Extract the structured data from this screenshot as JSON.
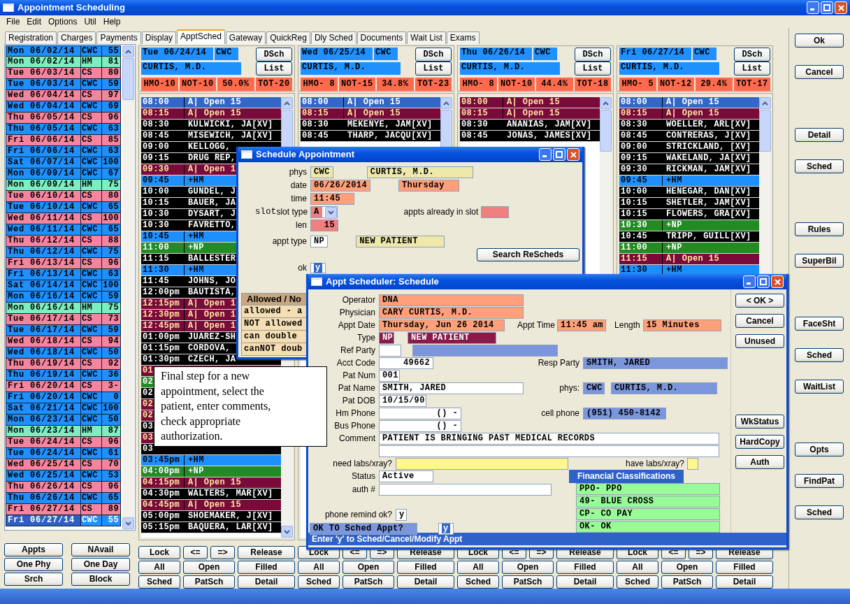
{
  "window": {
    "title": "Appointment Scheduling"
  },
  "menu": [
    "File",
    "Edit",
    "Options",
    "Util",
    "Help"
  ],
  "tabs": [
    {
      "label": "Registration",
      "selected": false
    },
    {
      "label": "Charges",
      "selected": false
    },
    {
      "label": "Payments",
      "selected": false
    },
    {
      "label": "Display",
      "selected": false
    },
    {
      "label": "ApptSched",
      "selected": true
    },
    {
      "label": "Gateway",
      "selected": false
    },
    {
      "label": "QuickReg",
      "selected": false
    },
    {
      "label": "Dly Sched",
      "selected": false
    },
    {
      "label": "Documents",
      "selected": false
    },
    {
      "label": "Wait List",
      "selected": false
    },
    {
      "label": "Exams",
      "selected": false
    }
  ],
  "date_list": {
    "items": [
      {
        "day": "Mon 06/02/14",
        "clinic": "CWC",
        "count": "55",
        "color": "#1e90ff",
        "selected": false
      },
      {
        "day": "Mon 06/02/14",
        "clinic": "HM",
        "count": "81",
        "color": "#7ceebf",
        "selected": false
      },
      {
        "day": "Tue 06/03/14",
        "clinic": "CS",
        "count": "80",
        "color": "#f7849e",
        "selected": false
      },
      {
        "day": "Tue 06/03/14",
        "clinic": "CWC",
        "count": "59",
        "color": "#1e90ff",
        "selected": false
      },
      {
        "day": "Wed 06/04/14",
        "clinic": "CS",
        "count": "97",
        "color": "#f7849e",
        "selected": false
      },
      {
        "day": "Wed 06/04/14",
        "clinic": "CWC",
        "count": "69",
        "color": "#1e90ff",
        "selected": false
      },
      {
        "day": "Thu 06/05/14",
        "clinic": "CS",
        "count": "96",
        "color": "#f7849e",
        "selected": false
      },
      {
        "day": "Thu 06/05/14",
        "clinic": "CWC",
        "count": "63",
        "color": "#1e90ff",
        "selected": false
      },
      {
        "day": "Fri 06/06/14",
        "clinic": "CS",
        "count": "85",
        "color": "#f7849e",
        "selected": false
      },
      {
        "day": "Fri 06/06/14",
        "clinic": "CWC",
        "count": "63",
        "color": "#1e90ff",
        "selected": false
      },
      {
        "day": "Sat 06/07/14",
        "clinic": "CWC",
        "count": "100",
        "color": "#1e90ff",
        "selected": false
      },
      {
        "day": "Mon 06/09/14",
        "clinic": "CWC",
        "count": "67",
        "color": "#1e90ff",
        "selected": false
      },
      {
        "day": "Mon 06/09/14",
        "clinic": "HM",
        "count": "75",
        "color": "#7ceebf",
        "selected": false
      },
      {
        "day": "Tue 06/10/14",
        "clinic": "CS",
        "count": "80",
        "color": "#f7849e",
        "selected": false
      },
      {
        "day": "Tue 06/10/14",
        "clinic": "CWC",
        "count": "65",
        "color": "#1e90ff",
        "selected": false
      },
      {
        "day": "Wed 06/11/14",
        "clinic": "CS",
        "count": "100",
        "color": "#f7849e",
        "selected": false
      },
      {
        "day": "Wed 06/11/14",
        "clinic": "CWC",
        "count": "65",
        "color": "#1e90ff",
        "selected": false
      },
      {
        "day": "Thu 06/12/14",
        "clinic": "CS",
        "count": "88",
        "color": "#f7849e",
        "selected": false
      },
      {
        "day": "Thu 06/12/14",
        "clinic": "CWC",
        "count": "75",
        "color": "#1e90ff",
        "selected": false
      },
      {
        "day": "Fri 06/13/14",
        "clinic": "CS",
        "count": "96",
        "color": "#f7849e",
        "selected": false
      },
      {
        "day": "Fri 06/13/14",
        "clinic": "CWC",
        "count": "63",
        "color": "#1e90ff",
        "selected": false
      },
      {
        "day": "Sat 06/14/14",
        "clinic": "CWC",
        "count": "100",
        "color": "#1e90ff",
        "selected": false
      },
      {
        "day": "Mon 06/16/14",
        "clinic": "CWC",
        "count": "59",
        "color": "#1e90ff",
        "selected": false
      },
      {
        "day": "Mon 06/16/14",
        "clinic": "HM",
        "count": "75",
        "color": "#7ceebf",
        "selected": false
      },
      {
        "day": "Tue 06/17/14",
        "clinic": "CS",
        "count": "73",
        "color": "#f7849e",
        "selected": false
      },
      {
        "day": "Tue 06/17/14",
        "clinic": "CWC",
        "count": "59",
        "color": "#1e90ff",
        "selected": false
      },
      {
        "day": "Wed 06/18/14",
        "clinic": "CS",
        "count": "94",
        "color": "#f7849e",
        "selected": false
      },
      {
        "day": "Wed 06/18/14",
        "clinic": "CWC",
        "count": "50",
        "color": "#1e90ff",
        "selected": false
      },
      {
        "day": "Thu 06/19/14",
        "clinic": "CS",
        "count": "92",
        "color": "#f7849e",
        "selected": false
      },
      {
        "day": "Thu 06/19/14",
        "clinic": "CWC",
        "count": "36",
        "color": "#1e90ff",
        "selected": false
      },
      {
        "day": "Fri 06/20/14",
        "clinic": "CS",
        "count": "3-",
        "color": "#f7849e",
        "selected": false
      },
      {
        "day": "Fri 06/20/14",
        "clinic": "CWC",
        "count": "0",
        "color": "#1e90ff",
        "selected": false
      },
      {
        "day": "Sat 06/21/14",
        "clinic": "CWC",
        "count": "100",
        "color": "#1e90ff",
        "selected": false
      },
      {
        "day": "Mon 06/23/14",
        "clinic": "CWC",
        "count": "50",
        "color": "#1e90ff",
        "selected": false
      },
      {
        "day": "Mon 06/23/14",
        "clinic": "HM",
        "count": "87",
        "color": "#7ceebf",
        "selected": false
      },
      {
        "day": "Tue 06/24/14",
        "clinic": "CS",
        "count": "96",
        "color": "#f7849e",
        "selected": false
      },
      {
        "day": "Tue 06/24/14",
        "clinic": "CWC",
        "count": "61",
        "color": "#1e90ff",
        "selected": false
      },
      {
        "day": "Wed 06/25/14",
        "clinic": "CS",
        "count": "70",
        "color": "#f7849e",
        "selected": false
      },
      {
        "day": "Wed 06/25/14",
        "clinic": "CWC",
        "count": "53",
        "color": "#1e90ff",
        "selected": false
      },
      {
        "day": "Thu 06/26/14",
        "clinic": "CS",
        "count": "96",
        "color": "#f7849e",
        "selected": false
      },
      {
        "day": "Thu 06/26/14",
        "clinic": "CWC",
        "count": "65",
        "color": "#1e90ff",
        "selected": false
      },
      {
        "day": "Fri 06/27/14",
        "clinic": "CS",
        "count": "89",
        "color": "#f7849e",
        "selected": false
      },
      {
        "day": "Fri 06/27/14",
        "clinic": "CWC",
        "count": "55",
        "color": "#1e90ff",
        "selected": true
      }
    ]
  },
  "left_buttons": [
    "Appts",
    "NAvail",
    "One Phy",
    "One Day",
    "Srch",
    "Block"
  ],
  "columns": [
    {
      "date": "Tue 06/24/14",
      "clinic": "CWC",
      "physician": "CURTIS, M.D.",
      "header_buttons": [
        "DSch",
        "List"
      ],
      "stats": [
        "HMO-10",
        "NOT-10",
        "50.0%",
        "TOT-20"
      ],
      "slots": [
        {
          "time": "08:00",
          "text": "A| Open 15",
          "kind": "open",
          "selected": true
        },
        {
          "time": "08:15",
          "text": "A| Open 15",
          "kind": "open",
          "selected": false
        },
        {
          "time": "08:30",
          "text": "KULWICKI, JA[XV]",
          "kind": "booked",
          "selected": false
        },
        {
          "time": "08:45",
          "text": "MISEWICH, JA[XV]",
          "kind": "booked",
          "selected": false
        },
        {
          "time": "09:00",
          "text": "KELLOGG,",
          "kind": "booked",
          "selected": false
        },
        {
          "time": "09:15",
          "text": "DRUG REP,",
          "kind": "booked",
          "selected": false
        },
        {
          "time": "09:30",
          "text": "A| Open 1",
          "kind": "open",
          "selected": false
        },
        {
          "time": "09:45",
          "text": "+HM",
          "kind": "hm",
          "selected": false
        },
        {
          "time": "10:00",
          "text": "GUNDEL, J",
          "kind": "booked",
          "selected": false
        },
        {
          "time": "10:15",
          "text": "BAUER, JA",
          "kind": "booked",
          "selected": false
        },
        {
          "time": "10:30",
          "text": "DYSART, J",
          "kind": "booked",
          "selected": false
        },
        {
          "time": "10:30",
          "text": "FAVRETTO,",
          "kind": "booked",
          "selected": false
        },
        {
          "time": "10:45",
          "text": "+HM",
          "kind": "hm",
          "selected": false
        },
        {
          "time": "11:00",
          "text": "+NP",
          "kind": "np",
          "selected": false
        },
        {
          "time": "11:15",
          "text": "BALLESTER",
          "kind": "booked",
          "selected": false
        },
        {
          "time": "11:30",
          "text": "+HM",
          "kind": "hm",
          "selected": false
        },
        {
          "time": "11:45",
          "text": "JOHNS, JO",
          "kind": "booked",
          "selected": false
        },
        {
          "time": "12:00pm",
          "text": "BAUTISTA,",
          "kind": "booked",
          "selected": false
        },
        {
          "time": "12:15pm",
          "text": "A| Open 1",
          "kind": "open",
          "selected": false
        },
        {
          "time": "12:30pm",
          "text": "A| Open 1",
          "kind": "open",
          "selected": false
        },
        {
          "time": "12:45pm",
          "text": "A| Open 1",
          "kind": "open",
          "selected": false
        },
        {
          "time": "01:00pm",
          "text": "JUAREZ-SH",
          "kind": "booked",
          "selected": false
        },
        {
          "time": "01:15pm",
          "text": "CORDOVA,",
          "kind": "booked",
          "selected": false
        },
        {
          "time": "01:30pm",
          "text": "CZECH, JA",
          "kind": "booked",
          "selected": false
        },
        {
          "time": "01",
          "kind": "open",
          "selected": false
        },
        {
          "time": "02",
          "kind": "np",
          "selected": false
        },
        {
          "time": "02",
          "kind": "booked",
          "selected": false
        },
        {
          "time": "02",
          "kind": "open",
          "selected": false
        },
        {
          "time": "02",
          "kind": "open",
          "selected": false
        },
        {
          "time": "03",
          "kind": "booked",
          "selected": false
        },
        {
          "time": "03",
          "kind": "open",
          "selected": false
        },
        {
          "time": "03",
          "kind": "booked",
          "selected": false
        },
        {
          "time": "03:45pm",
          "text": "+HM",
          "kind": "hm",
          "selected": false
        },
        {
          "time": "04:00pm",
          "text": "+NP",
          "kind": "np",
          "selected": false
        },
        {
          "time": "04:15pm",
          "text": "A| Open 15",
          "kind": "open",
          "selected": false
        },
        {
          "time": "04:30pm",
          "text": "WALTERS, MAR[XV]",
          "kind": "booked",
          "selected": false
        },
        {
          "time": "04:45pm",
          "text": "A| Open 15",
          "kind": "open",
          "selected": false
        },
        {
          "time": "05:00pm",
          "text": "SHOEMAKER, J[XV]",
          "kind": "booked",
          "selected": false
        },
        {
          "time": "05:15pm",
          "text": "BAQUERA, LAR[XV]",
          "kind": "booked",
          "selected": false
        }
      ],
      "bottom_buttons": [
        [
          "Lock",
          "<=",
          "=>",
          "Release"
        ],
        [
          "All",
          "Open",
          "Filled"
        ],
        [
          "Sched",
          "PatSch",
          "Detail"
        ]
      ]
    },
    {
      "date": "Wed 06/25/14",
      "clinic": "CWC",
      "physician": "CURTIS, M.D.",
      "header_buttons": [
        "DSch",
        "List"
      ],
      "stats": [
        "HMO- 8",
        "NOT-15",
        "34.8%",
        "TOT-23"
      ],
      "slots": [
        {
          "time": "08:00",
          "text": "A| Open 15",
          "kind": "open",
          "selected": true
        },
        {
          "time": "08:15",
          "text": "A| Open 15",
          "kind": "open",
          "selected": false
        },
        {
          "time": "08:30",
          "text": "MEKENYE, JAM[XV]",
          "kind": "booked",
          "selected": false
        },
        {
          "time": "08:45",
          "text": "THARP, JACQU[XV]",
          "kind": "booked",
          "selected": false
        }
      ],
      "bottom_buttons": [
        [
          "Lock",
          "<=",
          "=>",
          "Release"
        ],
        [
          "All",
          "Open",
          "Filled"
        ],
        [
          "Sched",
          "PatSch",
          "Detail"
        ]
      ]
    },
    {
      "date": "Thu 06/26/14",
      "clinic": "CWC",
      "physician": "CURTIS, M.D.",
      "header_buttons": [
        "DSch",
        "List"
      ],
      "stats": [
        "HMO- 8",
        "NOT-10",
        "44.4%",
        "TOT-18"
      ],
      "slots": [
        {
          "time": "08:00",
          "text": "A| Open 15",
          "kind": "open",
          "selected": false
        },
        {
          "time": "08:15",
          "text": "A| Open 15",
          "kind": "open",
          "selected": false
        },
        {
          "time": "08:30",
          "text": "ANANIAS, JAM[XV]",
          "kind": "booked",
          "selected": false
        },
        {
          "time": "08:45",
          "text": "JONAS, JAMES[XV]",
          "kind": "booked",
          "selected": false
        }
      ],
      "bottom_buttons": [
        [
          "Lock",
          "<=",
          "=>",
          "Release"
        ],
        [
          "All",
          "Open",
          "Filled"
        ],
        [
          "Sched",
          "PatSch",
          "Detail"
        ]
      ]
    },
    {
      "date": "Fri 06/27/14",
      "clinic": "CWC",
      "physician": "CURTIS, M.D.",
      "header_buttons": [
        "DSch",
        "List"
      ],
      "stats": [
        "HMO- 5",
        "NOT-12",
        "29.4%",
        "TOT-17"
      ],
      "slots": [
        {
          "time": "08:00",
          "text": "A| Open 15",
          "kind": "open",
          "selected": true
        },
        {
          "time": "08:15",
          "text": "A| Open 15",
          "kind": "open",
          "selected": false
        },
        {
          "time": "08:30",
          "text": "WOELLER, ARL[XV]",
          "kind": "booked",
          "selected": false
        },
        {
          "time": "08:45",
          "text": "CONTRERAS, J[XV]",
          "kind": "booked",
          "selected": false
        },
        {
          "time": "09:00",
          "text": "STRICKLAND, [XV]",
          "kind": "booked",
          "selected": false
        },
        {
          "time": "09:15",
          "text": "WAKELAND, JA[XV]",
          "kind": "booked",
          "selected": false
        },
        {
          "time": "09:30",
          "text": "RICKMAN, JAM[XV]",
          "kind": "booked",
          "selected": false
        },
        {
          "time": "09:45",
          "text": "+HM",
          "kind": "hm",
          "selected": false
        },
        {
          "time": "10:00",
          "text": "HENEGAR, DAN[XV]",
          "kind": "booked",
          "selected": false
        },
        {
          "time": "10:15",
          "text": "SHETLER, JAM[XV]",
          "kind": "booked",
          "selected": false
        },
        {
          "time": "10:15",
          "text": "FLOWERS, GRA[XV]",
          "kind": "booked",
          "selected": false
        },
        {
          "time": "10:30",
          "text": "+NP",
          "kind": "np",
          "selected": false
        },
        {
          "time": "10:45",
          "text": "TRIPP, GUILL[XV]",
          "kind": "booked",
          "selected": false
        },
        {
          "time": "11:00",
          "text": "+NP",
          "kind": "np",
          "selected": false
        },
        {
          "time": "11:15",
          "text": "A| Open 15",
          "kind": "open",
          "selected": false
        },
        {
          "time": "11:30",
          "text": "+HM",
          "kind": "hm",
          "selected": false
        }
      ],
      "bottom_buttons": [
        [
          "Lock",
          "<=",
          "=>",
          "Release"
        ],
        [
          "All",
          "Open",
          "Filled"
        ],
        [
          "Sched",
          "PatSch",
          "Detail"
        ]
      ]
    }
  ],
  "right_buttons": [
    [
      "Ok",
      "Cancel"
    ],
    [
      "Detail",
      "Sched"
    ],
    [
      "Rules",
      "SuperBil"
    ],
    [
      "FaceSht",
      "Sched",
      "WaitList"
    ],
    [
      "Opts",
      "FindPat",
      "Sched"
    ]
  ],
  "schedule_dialog": {
    "title": "Schedule Appointment",
    "phys_label": "phys",
    "phys_code": "CWC",
    "phys_name": "CURTIS, M.D.",
    "date_label": "date",
    "date": "06/26/2014",
    "weekday": "Thursday",
    "time_label": "time",
    "time": "11:45",
    "slot_label": "slot",
    "slot_type_label": "slot type",
    "slot_type": "A",
    "appts_in_slot_label": "appts already in slot",
    "len_label": "len",
    "len": "15",
    "appt_type_label": "appt type",
    "appt_type": "NP",
    "appt_type_name": "NEW PATIENT",
    "search_button": "Search ReScheds",
    "ok_label": "ok",
    "ok": "y",
    "allowed_header": "Allowed / No",
    "allowed_rows": [
      "allowed - a",
      "NOT allowed",
      "can double",
      "canNOT doub"
    ]
  },
  "scheduler_dialog": {
    "title": "Appt Scheduler: Schedule",
    "operator_label": "Operator",
    "operator": "DNA",
    "physician_label": "Physician",
    "physician": "CARY CURTIS, M.D.",
    "appt_date_label": "Appt Date",
    "appt_date": "Thursday, Jun 26 2014",
    "appt_time_label": "Appt Time",
    "appt_time": "11:45 am",
    "length_label": "Length",
    "length": "15 Minutes",
    "type_label": "Type",
    "type_code": "NP",
    "type_name": "NEW PATIENT",
    "ref_party_label": "Ref Party",
    "acct_code_label": "Acct Code",
    "acct_code": "49662",
    "resp_party_label": "Resp Party",
    "resp_party": "SMITH, JARED",
    "pat_num_label": "Pat Num",
    "pat_num": "001",
    "pat_name_label": "Pat Name",
    "pat_name": "SMITH, JARED",
    "phys_label": "phys:",
    "phys_code": "CWC",
    "phys_name": "CURTIS, M.D.",
    "pat_dob_label": "Pat DOB",
    "pat_dob": "10/15/90",
    "hm_phone_label": "Hm Phone",
    "hm_phone": "() -",
    "cell_phone_label": "cell phone",
    "cell_phone": "(951) 450-8142",
    "bus_phone_label": "Bus Phone",
    "bus_phone": "() -",
    "comment_label": "Comment",
    "comment": "PATIENT IS BRINGING PAST MEDICAL RECORDS",
    "need_labs_label": "need labs/xray?",
    "have_labs_label": "have labs/xray?",
    "status_label": "Status",
    "status": "Active",
    "auth_label": "auth #",
    "financial_header": "Financial Classifications",
    "financial": [
      "PPO- PPO",
      "49- BLUE CROSS",
      "CP- CO PAY",
      "OK- OK"
    ],
    "phone_remind_label": "phone remind ok?",
    "phone_remind": "y",
    "ok_to_sched_label": "OK TO Sched Appt?",
    "ok_to_sched": "y",
    "buttons": [
      [
        "< OK >",
        "Cancel",
        "Unused"
      ],
      [
        "WkStatus",
        "HardCopy",
        "Auth"
      ]
    ],
    "status_bar": "Enter 'y' to Sched/Cancel/Modify Appt"
  },
  "tooltip": {
    "text": "Final step for a new appointment, select the patient, enter comments, check appropriate authorization."
  }
}
